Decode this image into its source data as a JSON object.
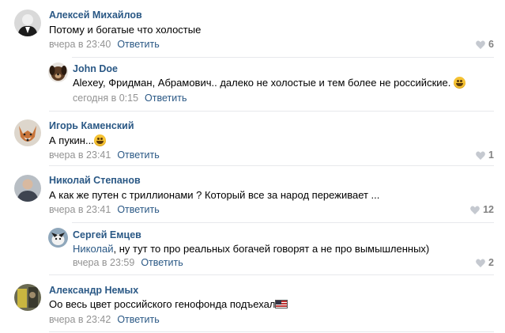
{
  "comments": [
    {
      "author": "Алексей Михайлов",
      "text": "Потому и богатые что холостые",
      "time": "вчера в 23:40",
      "reply_label": "Ответить",
      "likes": "6"
    },
    {
      "author": "John Doe",
      "text": "Alexey, Фридман, Абрамович.. далеко не холостые и тем более не российские.",
      "time": "сегодня в 0:15",
      "reply_label": "Ответить",
      "likes": ""
    },
    {
      "author": "Игорь Каменский",
      "text": "А пукин...",
      "time": "вчера в 23:41",
      "reply_label": "Ответить",
      "likes": "1"
    },
    {
      "author": "Николай Степанов",
      "text": "А как же путен с триллионами ? Который все за народ переживает ...",
      "time": "вчера в 23:41",
      "reply_label": "Ответить",
      "likes": "12"
    },
    {
      "author": "Сергей Емцев",
      "mention": "Николай",
      "text": ", ну тут то про реальных богачей говорят а не про вымышленных)",
      "time": "вчера в 23:59",
      "reply_label": "Ответить",
      "likes": "2"
    },
    {
      "author": "Александр Немых",
      "text": "Оо весь цвет российского генофонда подъехал",
      "time": "вчера в 23:42",
      "reply_label": "Ответить",
      "likes": ""
    }
  ],
  "colors": {
    "link": "#2a5885",
    "meta": "#939393",
    "divider": "#e7e8ec"
  },
  "icons": {
    "like": "heart-icon"
  }
}
